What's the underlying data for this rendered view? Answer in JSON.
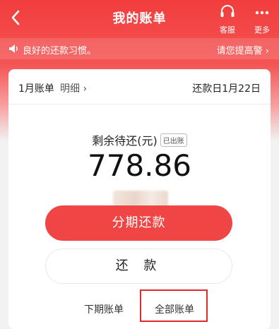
{
  "nav": {
    "title": "我的账单",
    "customer_service_label": "客服",
    "more_label": "更多"
  },
  "notice": {
    "text": "良好的还款习惯。",
    "link": "请您提高警"
  },
  "bill": {
    "month": "1月账单",
    "detail": "明细",
    "due_date": "还款日1月22日",
    "remaining_label": "剩余待还(元)",
    "status_badge": "已出账",
    "amount": "778.86"
  },
  "buttons": {
    "installment": "分期还款",
    "repay": "还 款"
  },
  "links": {
    "next_bill": "下期账单",
    "all_bills": "全部账单"
  },
  "colors": {
    "brand_red": "#f04545",
    "highlight": "#e02b2b"
  }
}
